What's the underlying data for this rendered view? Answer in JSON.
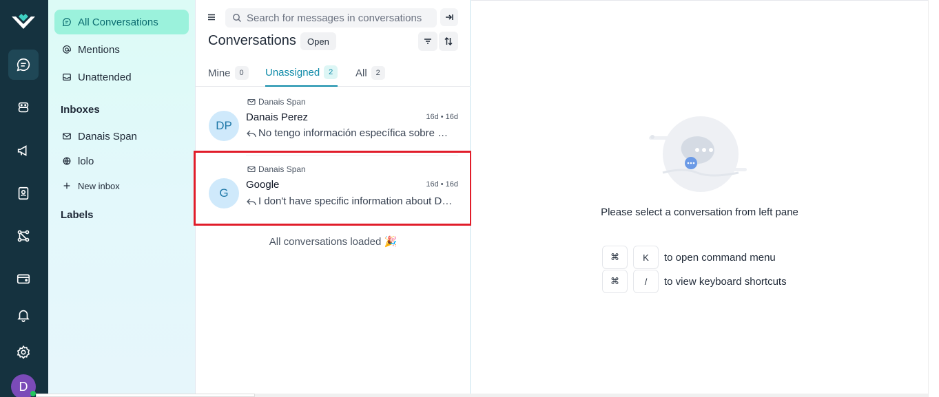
{
  "rail": {
    "items": [
      "conversations-icon",
      "bot-icon",
      "megaphone-icon",
      "contacts-icon",
      "flow-icon",
      "wallet-icon",
      "bell-icon",
      "gear-icon"
    ],
    "avatar_initial": "D"
  },
  "sidebar": {
    "items": [
      {
        "label": "All Conversations",
        "icon": "chat-icon"
      },
      {
        "label": "Mentions",
        "icon": "at-icon"
      },
      {
        "label": "Unattended",
        "icon": "inbox-icon"
      }
    ],
    "inboxes_heading": "Inboxes",
    "inboxes": [
      {
        "label": "Danais Span",
        "icon": "mail-icon"
      },
      {
        "label": "lolo",
        "icon": "globe-icon"
      }
    ],
    "new_inbox": "New inbox",
    "labels_heading": "Labels"
  },
  "conversations": {
    "search_placeholder": "Search for messages in conversations",
    "title": "Conversations",
    "status": "Open",
    "tabs": [
      {
        "label": "Mine",
        "count": "0"
      },
      {
        "label": "Unassigned",
        "count": "2"
      },
      {
        "label": "All",
        "count": "2"
      }
    ],
    "list": [
      {
        "inbox": "Danais Span",
        "initials": "DP",
        "name": "Danais Perez",
        "time": "16d • 16d",
        "message": "No tengo información específica sobre Danais Span."
      },
      {
        "inbox": "Danais Span",
        "initials": "G",
        "name": "Google",
        "time": "16d • 16d",
        "message": "I don't have specific information about Danais Span."
      }
    ],
    "loaded_text": "All conversations loaded 🎉"
  },
  "main": {
    "empty_message": "Please select a conversation from left pane",
    "shortcuts": [
      {
        "key1": "⌘",
        "key2": "K",
        "label": "to open command menu"
      },
      {
        "key1": "⌘",
        "key2": "/",
        "label": "to view keyboard shortcuts"
      }
    ]
  },
  "colors": {
    "rail_bg": "#15323f",
    "active_item_bg": "#9bf2dc",
    "accent": "#0e8aa8",
    "highlight": "#e11d2a"
  }
}
